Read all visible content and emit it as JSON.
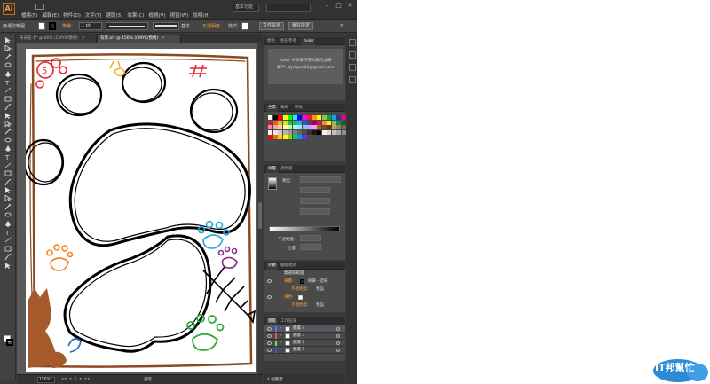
{
  "menubar": {
    "logo": "Ai",
    "items": [
      "檔案(F)",
      "編輯(E)",
      "物件(O)",
      "文字(T)",
      "選取(S)",
      "效果(C)",
      "檢視(V)",
      "視窗(W)",
      "說明(H)"
    ],
    "workspace": "基本功能",
    "window_buttons": [
      "–",
      "□",
      "✕"
    ]
  },
  "controlbar": {
    "selection_label": "無選取範圍",
    "stroke_label": "筆畫:",
    "stroke_value": "1 pt",
    "brush_label": "基本",
    "opacity_label": "不透明度",
    "style_label": "樣式:",
    "doc_setup": "文件設定",
    "preferences": "偏好設定"
  },
  "tabs": [
    {
      "label": "未命名-1* @ 66% (CMYK/預視)",
      "active": false
    },
    {
      "label": "背景.ai* @ 156% (CMYK/預視)",
      "active": true
    }
  ],
  "statusbar": {
    "zoom": "156%",
    "nav": "◂◂ ◂ 1 ▸ ▸▸",
    "status": "選取"
  },
  "panels": {
    "top_tabs": [
      "顏色",
      "色彩參考",
      "Kuler"
    ],
    "kuler_text_1": "Kuler 中沒有可用的顏色主題",
    "kuler_text_2": "帳戶: stylepan12@gmail.com",
    "swatch_tabs": [
      "色票",
      "筆刷",
      "符號"
    ],
    "grad_tabs": [
      "漸層",
      "透明度"
    ],
    "grad_type_label": "類型:",
    "opacity_label": "不透明度:",
    "position_label": "位置:",
    "appearance_tabs": [
      "外觀",
      "繪圖樣式"
    ],
    "appearance_title": "無選取範圍",
    "stroke_row": "筆畫:",
    "brush_row": "刷筆 - 塗抹",
    "opacity_row_1": "不透明度:",
    "default_1": "預設",
    "fill_row": "填色:",
    "opacity_row_2": "不透明度:",
    "default_2": "預設",
    "layers_tabs": [
      "圖層",
      "工作區域"
    ],
    "layers": [
      {
        "name": "圖層 4",
        "color": "#4a7cff"
      },
      {
        "name": "圖層 3",
        "color": "#ff4a4a"
      },
      {
        "name": "圖層 2",
        "color": "#4aff4a"
      },
      {
        "name": "圖層 1",
        "color": "#4a4aff"
      }
    ],
    "layers_count": "4 個圖層"
  },
  "swatch_colors": [
    "#ffffff",
    "#000000",
    "#ff0000",
    "#ffff00",
    "#00ff00",
    "#00ffff",
    "#0000ff",
    "#ff00ff",
    "#ed1c24",
    "#f7941d",
    "#fff200",
    "#8dc63f",
    "#00a651",
    "#00aeef",
    "#2e3192",
    "#ec008c",
    "#c1272d",
    "#f15a24",
    "#fbb03b",
    "#d9e021",
    "#39b54a",
    "#22b573",
    "#29abe2",
    "#0071bc",
    "#662d91",
    "#9e005d",
    "#d4145a",
    "#f7931e",
    "#fcee21",
    "#8cc63f",
    "#009245",
    "#006837",
    "#ff7bac",
    "#ffa0a0",
    "#ffd5a0",
    "#fffca0",
    "#c8ffa0",
    "#a0ffd5",
    "#a0e5ff",
    "#a0b5ff",
    "#c6a0ff",
    "#ffa0e5",
    "#996633",
    "#754c24",
    "#603813",
    "#c69c6d",
    "#a67c52",
    "#8c6239",
    "#ffffff",
    "#e6e6e6",
    "#cccccc",
    "#b3b3b3",
    "#999999",
    "#808080",
    "#666666",
    "#4d4d4d",
    "#333333",
    "#1a1a1a",
    "#000000",
    "#f2f2f2",
    "#dadada",
    "#c0c0c0",
    "#a6a6a6",
    "#8c8c8c",
    "#ff0000",
    "#ff6600",
    "#ffcc00",
    "#ffff00",
    "#99cc00",
    "#00cc66",
    "#0099ff",
    "#6633ff"
  ],
  "watermark": "IT邦幫忙"
}
